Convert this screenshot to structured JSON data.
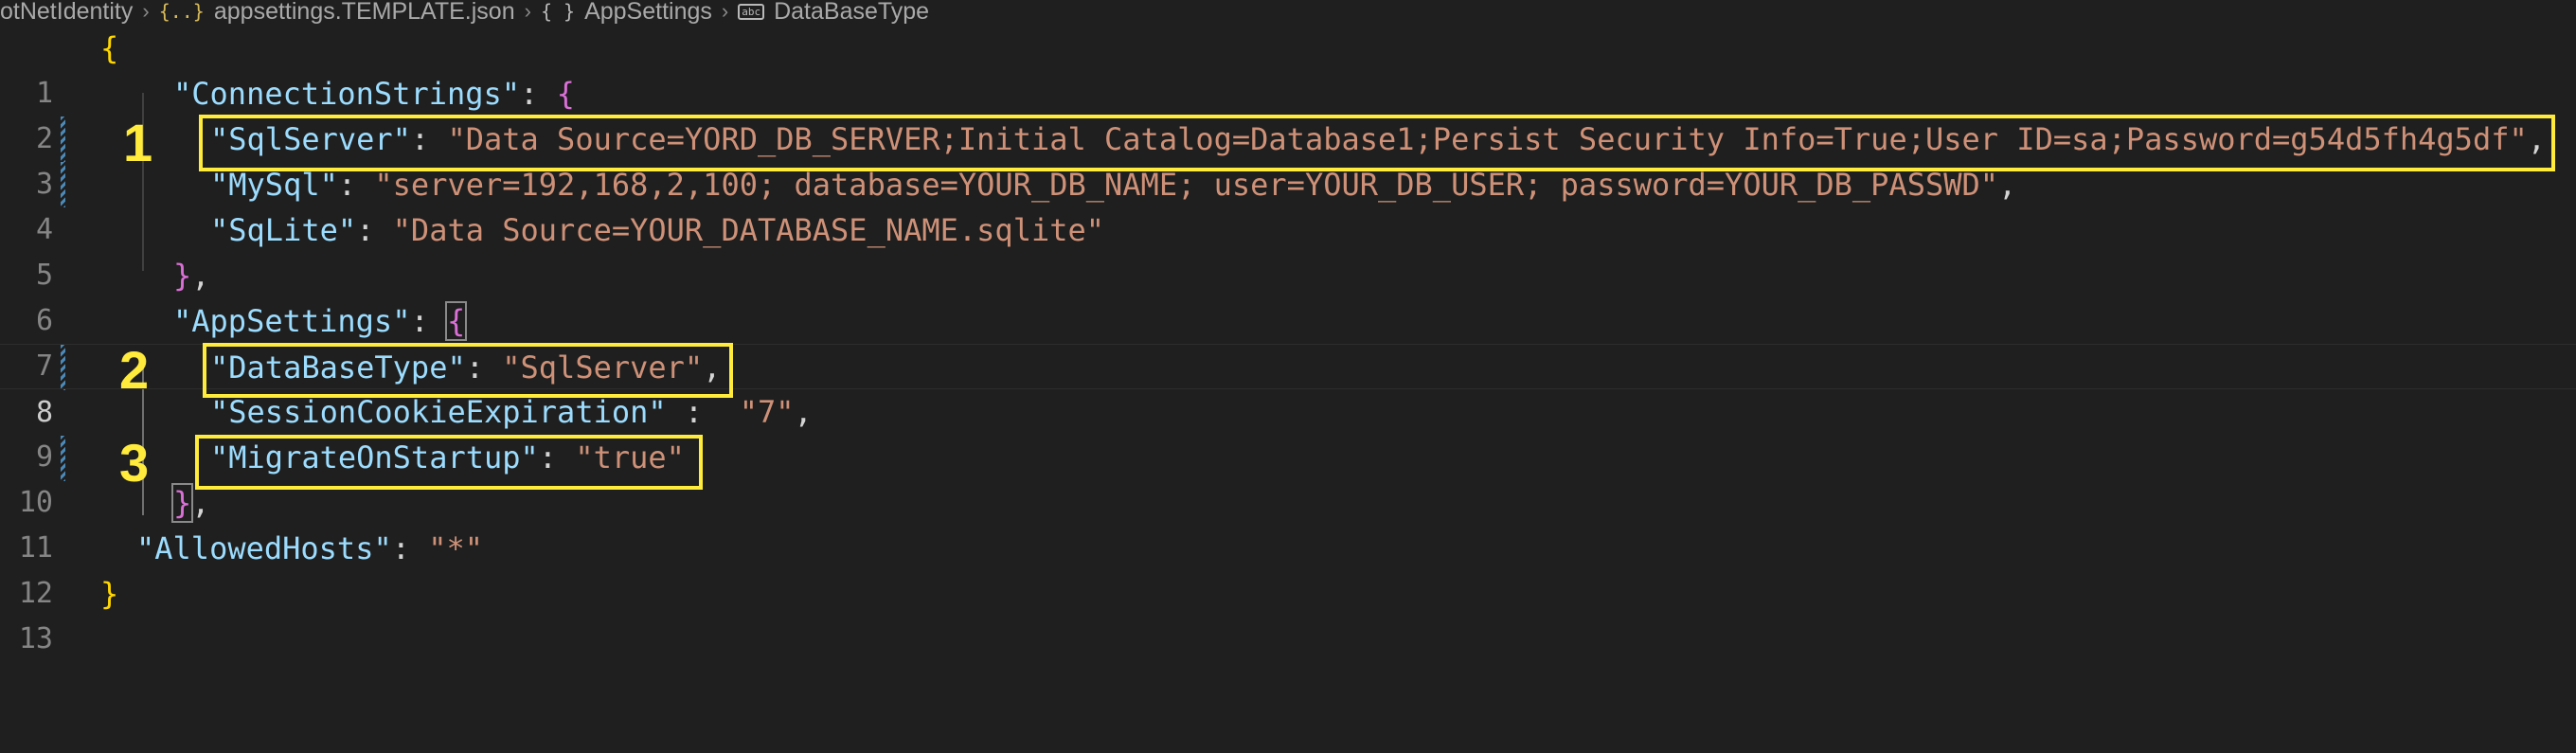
{
  "breadcrumb": {
    "items": [
      {
        "label": "otNetIdentity",
        "icon": ""
      },
      {
        "label": "appsettings.TEMPLATE.json",
        "icon": "json-braces-icon"
      },
      {
        "label": "AppSettings",
        "icon": "object-braces-icon"
      },
      {
        "label": "DataBaseType",
        "icon": "string-icon"
      }
    ]
  },
  "editor": {
    "line_numbers": [
      "1",
      "2",
      "3",
      "4",
      "5",
      "6",
      "7",
      "8",
      "9",
      "10",
      "11",
      "12",
      "13"
    ],
    "active_line": "8",
    "code": {
      "l1_open": "{",
      "l2_key": "\"ConnectionStrings\"",
      "l2_colon": ": ",
      "l2_brace": "{",
      "l3_key": "\"SqlServer\"",
      "l3_colon": ": ",
      "l3_val": "\"Data Source=YORD_DB_SERVER;Initial Catalog=Database1;Persist Security Info=True;User ID=sa;Password=g54d5fh4g5df\"",
      "l3_comma": ",",
      "l4_key": "\"MySql\"",
      "l4_colon": ": ",
      "l4_val": "\"server=192,168,2,100; database=YOUR_DB_NAME; user=YOUR_DB_USER; password=YOUR_DB_PASSWD\"",
      "l4_comma": ",",
      "l5_key": "\"SqLite\"",
      "l5_colon": ": ",
      "l5_val": "\"Data Source=YOUR_DATABASE_NAME.sqlite\"",
      "l6_close": "}",
      "l6_comma": ",",
      "l7_key": "\"AppSettings\"",
      "l7_colon": ": ",
      "l7_brace": "{",
      "l8_key": "\"DataBaseType\"",
      "l8_colon": ": ",
      "l8_val": "\"SqlServer\"",
      "l8_comma": ",",
      "l9_key": "\"SessionCookieExpiration\"",
      "l9_colon": " :  ",
      "l9_val": "\"7\"",
      "l9_comma": ",",
      "l10_key": "\"MigrateOnStartup\"",
      "l10_colon": ": ",
      "l10_val": "\"true\"",
      "l11_close": "}",
      "l11_comma": ",",
      "l12_key": "\"AllowedHosts\"",
      "l12_colon": ": ",
      "l12_val": "\"*\"",
      "l13_close": "}"
    }
  },
  "annotations": [
    {
      "number": "1",
      "color": "#ffeb3b"
    },
    {
      "number": "2",
      "color": "#ffeb3b"
    },
    {
      "number": "3",
      "color": "#ffeb3b"
    }
  ],
  "colors": {
    "background": "#1f1f1f",
    "key": "#9cdcfe",
    "string": "#ce9178",
    "bracket_outer": "#ffd700",
    "bracket_inner": "#da70d6",
    "annotation": "#ffeb3b"
  }
}
